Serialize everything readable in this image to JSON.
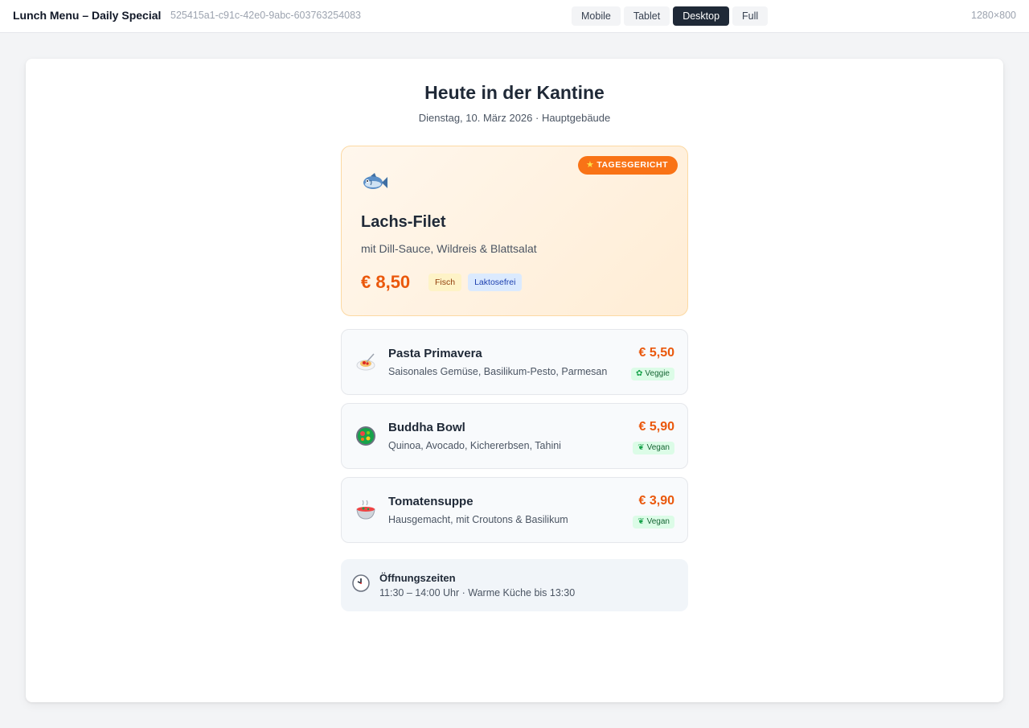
{
  "topbar": {
    "title": "Lunch Menu – Daily Special",
    "uuid": "525415a1-c91c-42e0-9abc-603763254083",
    "views": [
      "Mobile",
      "Tablet",
      "Desktop",
      "Full"
    ],
    "active_view": "Desktop",
    "dimensions": "1280×800"
  },
  "page": {
    "heading": "Heute in der Kantine",
    "subheading": "Dienstag, 10. März 2026 · Hauptgebäude"
  },
  "featured": {
    "badge": "TAGESGERICHT",
    "badge_icon": "star-icon",
    "icon": "fish-icon",
    "name": "Lachs-Filet",
    "description": "mit Dill-Sauce, Wildreis & Blattsalat",
    "price": "€ 8,50",
    "tags": [
      "Fisch",
      "Laktosefrei"
    ]
  },
  "items": [
    {
      "icon": "spaghetti-icon",
      "name": "Pasta Primavera",
      "description": "Saisonales Gemüse, Basilikum-Pesto, Parmesan",
      "price": "€ 5,50",
      "diet": "Veggie",
      "diet_icon": "seedling-icon"
    },
    {
      "icon": "salad-bowl-icon",
      "name": "Buddha Bowl",
      "description": "Quinoa, Avocado, Kichererbsen, Tahini",
      "price": "€ 5,90",
      "diet": "Vegan",
      "diet_icon": "herb-icon"
    },
    {
      "icon": "soup-bowl-icon",
      "name": "Tomatensuppe",
      "description": "Hausgemacht, mit Croutons & Basilikum",
      "price": "€ 3,90",
      "diet": "Vegan",
      "diet_icon": "herb-icon"
    }
  ],
  "hours": {
    "icon": "clock-icon",
    "title": "Öffnungszeiten",
    "text": "11:30 – 14:00 Uhr · Warme Küche bis 13:30"
  },
  "colors": {
    "accent": "#ea580c",
    "badge": "#f97316",
    "dark": "#1f2937"
  }
}
